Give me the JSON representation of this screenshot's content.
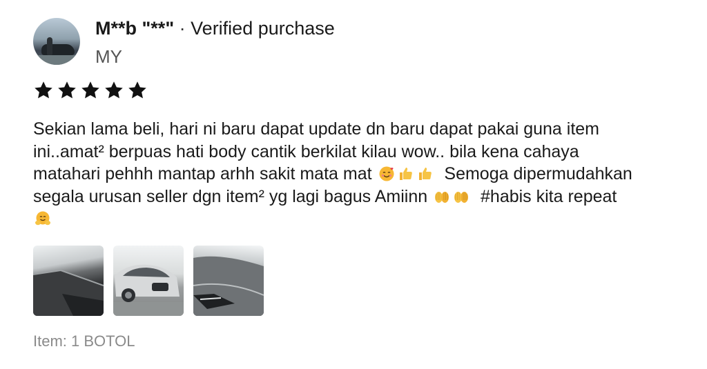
{
  "user": {
    "name": "M**b \"**\"",
    "separator": "·",
    "badge": "Verified purchase",
    "country": "MY"
  },
  "rating": {
    "stars": 5,
    "max": 5,
    "star_color": "#111111"
  },
  "review": {
    "lines": [
      "Sekian lama beli, hari ni baru dapat update dn baru dapat pakai guna item",
      "ini..amat² berpuas hati body cantik berkilat kilau wow.. bila kena cahaya",
      "matahari pehhh mantap arhh sakit mata mat",
      "Semoga dipermudahkan",
      "segala urusan seller dgn item² yg lagi bagus Amiinn",
      "#habis kita repeat"
    ],
    "emojis": [
      "smiling-face-with-hearts",
      "thumbs-up",
      "thumbs-up",
      "open-hands",
      "open-hands",
      "hugging-face"
    ]
  },
  "photos": [
    {
      "name": "review-photo-1"
    },
    {
      "name": "review-photo-2"
    },
    {
      "name": "review-photo-3"
    }
  ],
  "variation": "Item: 1 BOTOL"
}
